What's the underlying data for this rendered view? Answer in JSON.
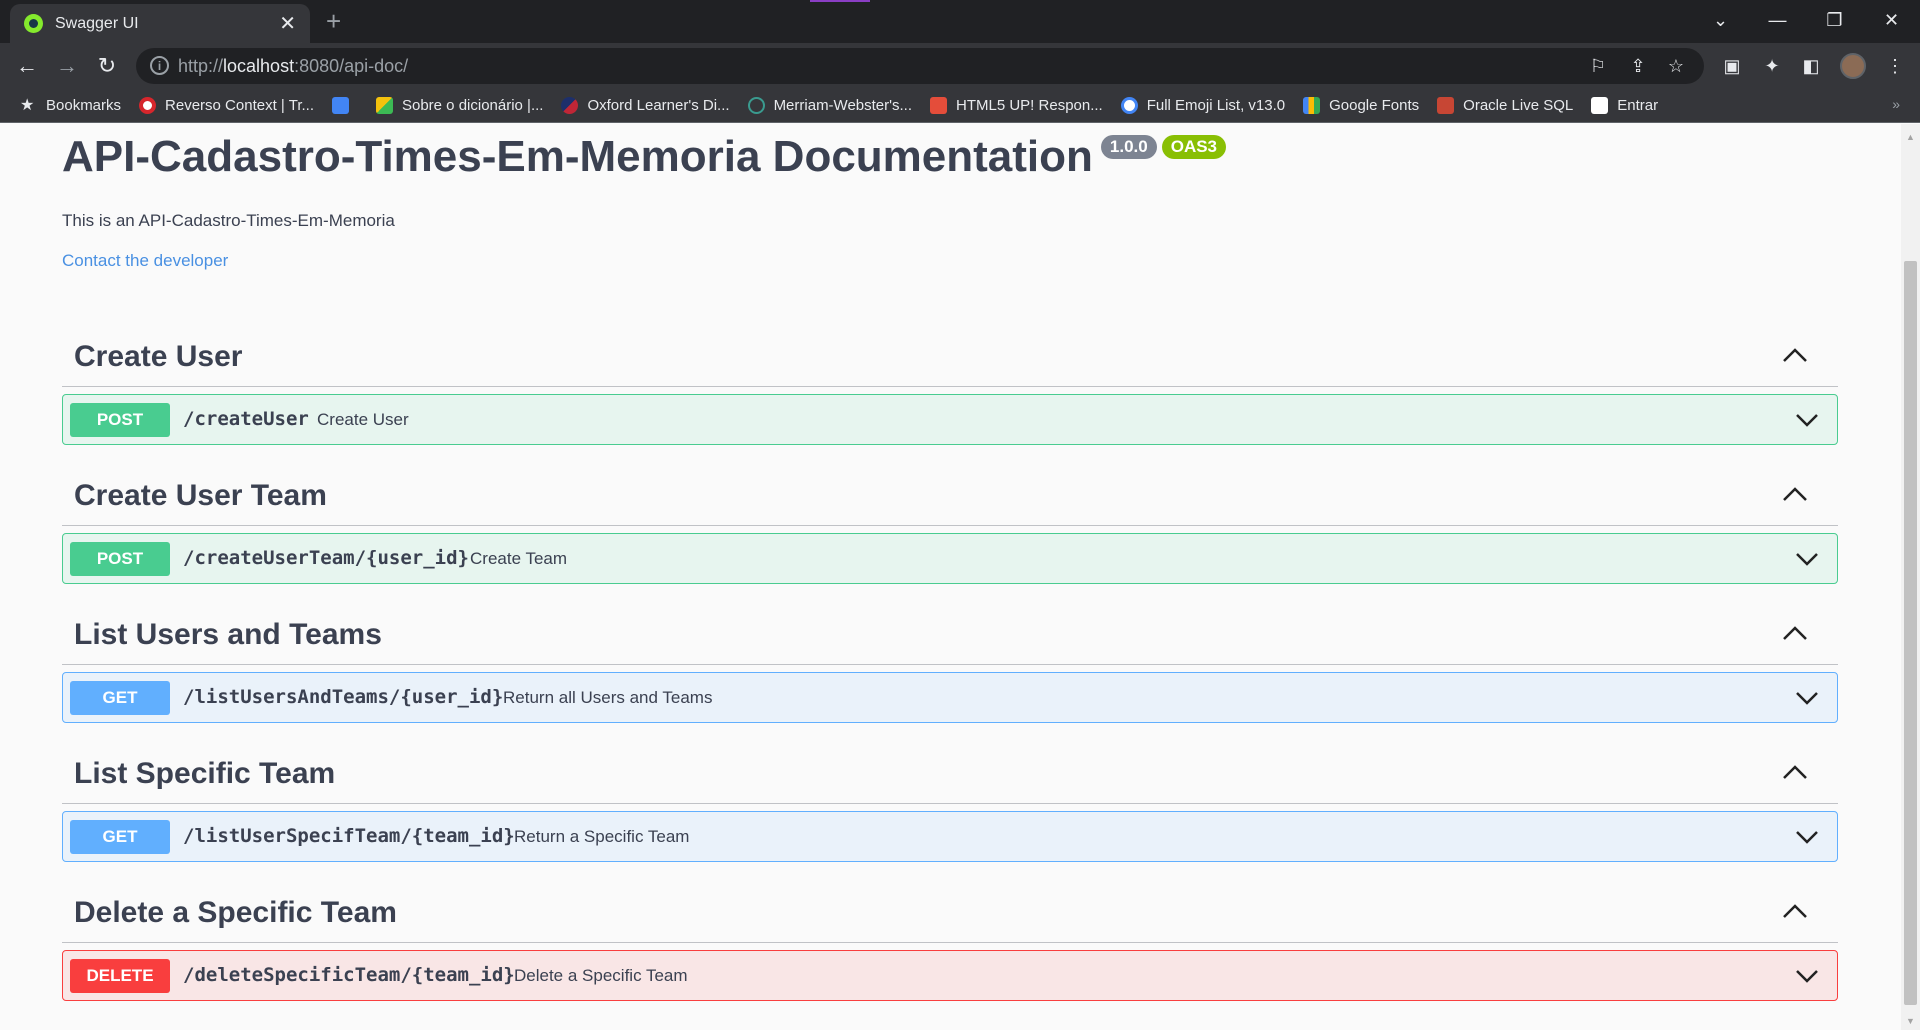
{
  "browser": {
    "tab_title": "Swagger UI",
    "url_scheme": "http://",
    "url_host": "localhost",
    "url_rest": ":8080/api-doc/",
    "bookmarks": [
      {
        "label": "Bookmarks",
        "icon": "star-icon"
      },
      {
        "label": "Reverso Context | Tr...",
        "icon": "reverso-icon"
      },
      {
        "label": "",
        "icon": "google-translate-icon"
      },
      {
        "label": "Sobre o dicionário |...",
        "icon": "dicionario-icon"
      },
      {
        "label": "Oxford Learner's Di...",
        "icon": "oxford-icon"
      },
      {
        "label": "Merriam-Webster's...",
        "icon": "globe-icon"
      },
      {
        "label": "HTML5 UP! Respon...",
        "icon": "html5up-icon"
      },
      {
        "label": "Full Emoji List, v13.0",
        "icon": "google-icon"
      },
      {
        "label": "Google Fonts",
        "icon": "google-fonts-icon"
      },
      {
        "label": "Oracle Live SQL",
        "icon": "oracle-icon"
      },
      {
        "label": "Entrar",
        "icon": "entrar-icon"
      }
    ]
  },
  "info": {
    "title": "API-Cadastro-Times-Em-Memoria Documentation",
    "version": "1.0.0",
    "oas": "OAS3",
    "description": "This is an API-Cadastro-Times-Em-Memoria",
    "contact_link": "Contact the developer"
  },
  "sections": [
    {
      "title": "Create User",
      "method": "POST",
      "path": "/createUser",
      "summary": "Create User"
    },
    {
      "title": "Create User Team",
      "method": "POST",
      "path": "/createUserTeam/{user_id}",
      "summary": "Create Team"
    },
    {
      "title": "List Users and Teams",
      "method": "GET",
      "path": "/listUsersAndTeams/{user_id}",
      "summary": "Return all Users and Teams"
    },
    {
      "title": "List Specific Team",
      "method": "GET",
      "path": "/listUserSpecifTeam/{team_id}",
      "summary": "Return a Specific Team"
    },
    {
      "title": "Delete a Specific Team",
      "method": "DELETE",
      "path": "/deleteSpecificTeam/{team_id}",
      "summary": "Delete a Specific Team"
    }
  ],
  "colors": {
    "post": "#49cc90",
    "get": "#61affe",
    "delete": "#f93e3e",
    "text": "#3b4151",
    "link": "#4990e2"
  }
}
